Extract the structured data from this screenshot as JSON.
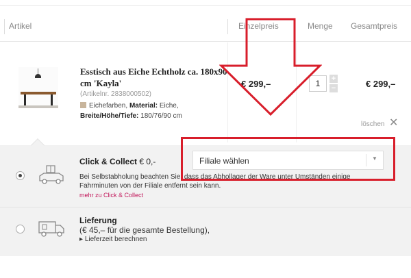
{
  "header": {
    "artikel": "Artikel",
    "einzelpreis": "Einzelpreis",
    "menge": "Menge",
    "gesamtpreis": "Gesamtpreis"
  },
  "product": {
    "title": "Esstisch aus Eiche Echtholz ca. 180x90 cm 'Kayla'",
    "artno": "(Artikelnr. 2838000502)",
    "color": "Eichefarben,",
    "material_label": "Material:",
    "material_value": "Eiche,",
    "dims_label": "Breite/Höhe/Tiefe:",
    "dims_value": "180/76/90 cm",
    "unit_price": "€ 299,–",
    "quantity": "1",
    "qty_plus": "+",
    "qty_minus": "−",
    "total_price": "€ 299,–",
    "delete_label": "löschen",
    "delete_icon": "✕"
  },
  "shipping": {
    "click_collect": {
      "title": "Click & Collect",
      "price": "€ 0,-",
      "note": "Bei Selbstabholung beachten Sie, dass das Abhollager der Ware unter Umständen einige Fahrminuten von der Filiale entfernt sein kann.",
      "link": "mehr zu Click & Collect",
      "selected": true,
      "icon": "car-with-furniture-icon"
    },
    "branch_select": {
      "value": "Filiale wählen",
      "arrow": "▼"
    },
    "lieferung": {
      "title": "Lieferung",
      "subtitle": "(€ 45,– für die gesamte Bestellung),",
      "link": "Lieferzeit berechnen",
      "link_marker": "▸",
      "selected": false,
      "icon": "delivery-truck-icon"
    }
  },
  "colors": {
    "accent_link": "#c2185b",
    "annotation": "#d81e2b"
  }
}
